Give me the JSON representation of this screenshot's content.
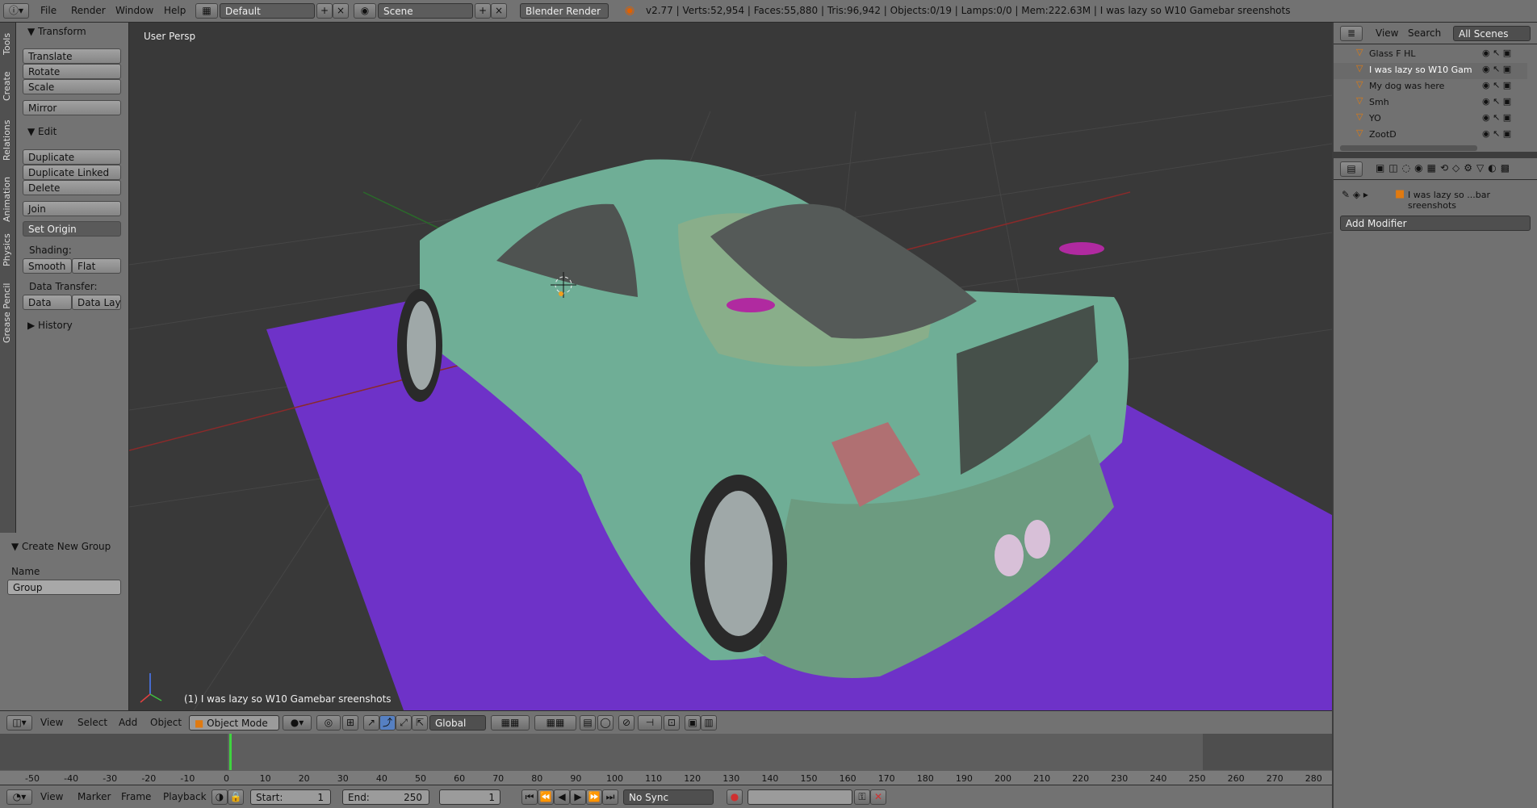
{
  "top": {
    "menus": [
      "File",
      "Render",
      "Window",
      "Help"
    ],
    "layout": "Default",
    "scene": "Scene",
    "engine": "Blender Render",
    "stats": "v2.77 | Verts:52,954 | Faces:55,880 | Tris:96,942 | Objects:0/19 | Lamps:0/0 | Mem:222.63M | I was lazy so W10 Gamebar sreenshots"
  },
  "tabs": [
    "Tools",
    "Create",
    "Relations",
    "Animation",
    "Physics",
    "Grease Pencil"
  ],
  "toolshelf": {
    "transform_title": "Transform",
    "transform_buttons": [
      "Translate",
      "Rotate",
      "Scale",
      "Mirror"
    ],
    "edit_title": "Edit",
    "edit_buttons": [
      "Duplicate",
      "Duplicate Linked",
      "Delete",
      "Join"
    ],
    "set_origin": "Set Origin",
    "shading_label": "Shading:",
    "smooth": "Smooth",
    "flat": "Flat",
    "data_transfer_label": "Data Transfer:",
    "data": "Data",
    "data_layout": "Data Layo",
    "history_title": "History",
    "group_title": "Create New Group",
    "name_label": "Name",
    "group_value": "Group"
  },
  "viewport": {
    "persp": "User Persp",
    "object_info": "(1) I was lazy so W10 Gamebar sreenshots"
  },
  "outliner": {
    "view": "View",
    "search": "Search",
    "filter": "All Scenes",
    "items": [
      "Glass F HL",
      "I was lazy so W10 Gam",
      "My dog was here",
      "Smh",
      "YO",
      "ZootD"
    ]
  },
  "properties": {
    "object_name": "I was lazy so ...bar sreenshots",
    "add_modifier": "Add Modifier"
  },
  "view_header": {
    "menus": [
      "View",
      "Select",
      "Add",
      "Object"
    ],
    "mode": "Object Mode",
    "orientation": "Global"
  },
  "timeline": {
    "ticks": [
      "-50",
      "-40",
      "-30",
      "-20",
      "-10",
      "0",
      "10",
      "20",
      "30",
      "40",
      "50",
      "60",
      "70",
      "80",
      "90",
      "100",
      "110",
      "120",
      "130",
      "140",
      "150",
      "160",
      "170",
      "180",
      "190",
      "200",
      "210",
      "220",
      "230",
      "240",
      "250",
      "260",
      "270",
      "280"
    ]
  },
  "timeline_header": {
    "menus": [
      "View",
      "Marker",
      "Frame",
      "Playback"
    ],
    "start_label": "Start:",
    "start_value": "1",
    "end_label": "End:",
    "end_value": "250",
    "current": "1",
    "sync": "No Sync"
  },
  "colors": {
    "car_body": "#6fae96",
    "floor": "#6e32c8",
    "viewport_bg": "#393939"
  }
}
